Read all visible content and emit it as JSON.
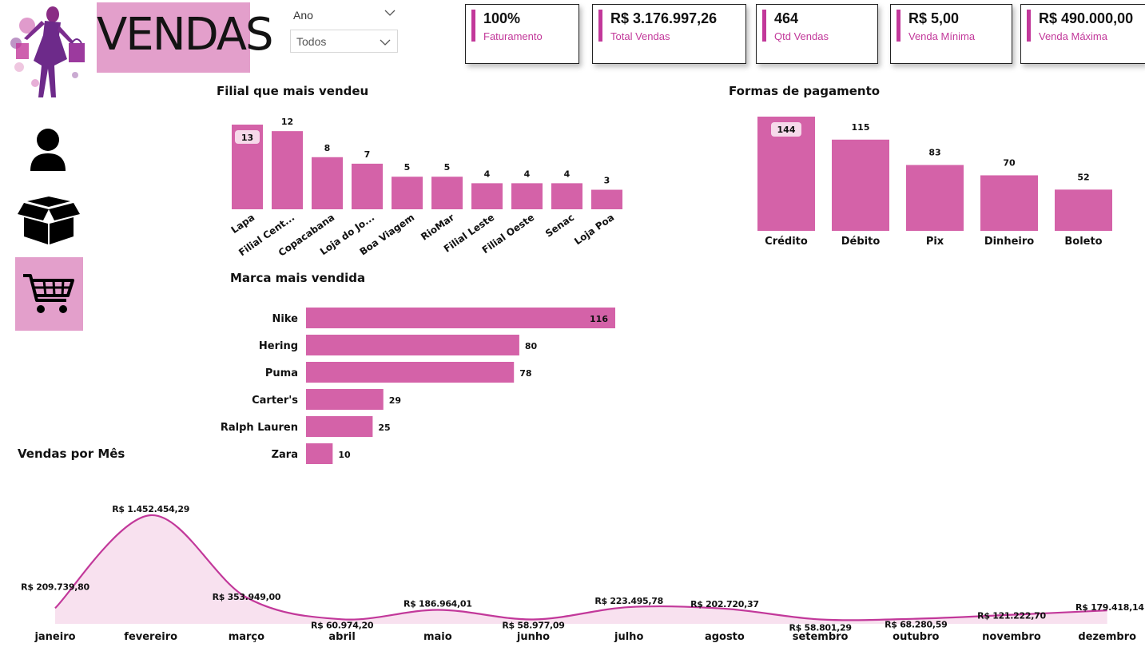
{
  "header": {
    "title": "VENDAS",
    "filter_label": "Ano",
    "filter_value": "Todos"
  },
  "kpis": [
    {
      "value": "100%",
      "label": "Faturamento"
    },
    {
      "value": "R$ 3.176.997,26",
      "label": "Total Vendas"
    },
    {
      "value": "464",
      "label": "Qtd Vendas"
    },
    {
      "value": "R$ 5,00",
      "label": "Venda Mínima"
    },
    {
      "value": "R$ 490.000,00",
      "label": "Venda Máxima"
    }
  ],
  "nav": {
    "icons": [
      "user-icon",
      "box-icon",
      "cart-icon"
    ],
    "active": "cart-icon"
  },
  "colors": {
    "accent": "#d462a8",
    "accent_dark": "#c2389a",
    "title_bg": "#e39fcb",
    "area_fill": "#f8e1ef",
    "line": "#c2389a"
  },
  "chart_data": [
    {
      "id": "filial",
      "type": "bar",
      "title": "Filial que mais vendeu",
      "categories": [
        "Lapa",
        "Filial Cent...",
        "Copacabana",
        "Loja do Jo...",
        "Boa Viagem",
        "RioMar",
        "Filial Leste",
        "Filial Oeste",
        "Senac",
        "Loja Poa"
      ],
      "values": [
        13,
        12,
        8,
        7,
        5,
        5,
        4,
        4,
        4,
        3
      ],
      "ylim": [
        0,
        13
      ]
    },
    {
      "id": "pagamento",
      "type": "bar",
      "title": "Formas de pagamento",
      "categories": [
        "Crédito",
        "Débito",
        "Pix",
        "Dinheiro",
        "Boleto"
      ],
      "values": [
        144,
        115,
        83,
        70,
        52
      ],
      "ylim": [
        0,
        144
      ]
    },
    {
      "id": "marca",
      "type": "bar",
      "orientation": "horizontal",
      "title": "Marca mais vendida",
      "categories": [
        "Nike",
        "Hering",
        "Puma",
        "Carter's",
        "Ralph Lauren",
        "Zara"
      ],
      "values": [
        116,
        80,
        78,
        29,
        25,
        10
      ],
      "xlim": [
        0,
        116
      ]
    },
    {
      "id": "mes",
      "type": "area",
      "title": "Vendas por Mês",
      "categories": [
        "janeiro",
        "fevereiro",
        "março",
        "abril",
        "maio",
        "junho",
        "julho",
        "agosto",
        "setembro",
        "outubro",
        "novembro",
        "dezembro"
      ],
      "values": [
        209739.8,
        1452454.29,
        353949.0,
        60974.2,
        186964.01,
        58977.09,
        223495.78,
        202720.37,
        58801.29,
        68280.59,
        121222.7,
        179418.14
      ],
      "value_labels": [
        "R$ 209.739,80",
        "R$ 1.452.454,29",
        "R$ 353.949,00",
        "R$ 60.974,20",
        "R$ 186.964,01",
        "R$ 58.977,09",
        "R$ 223.495,78",
        "R$ 202.720,37",
        "R$ 58.801,29",
        "R$ 68.280,59",
        "R$ 121.222,70",
        "R$ 179.418,14"
      ],
      "ylim": [
        0,
        1452454.29
      ]
    }
  ]
}
